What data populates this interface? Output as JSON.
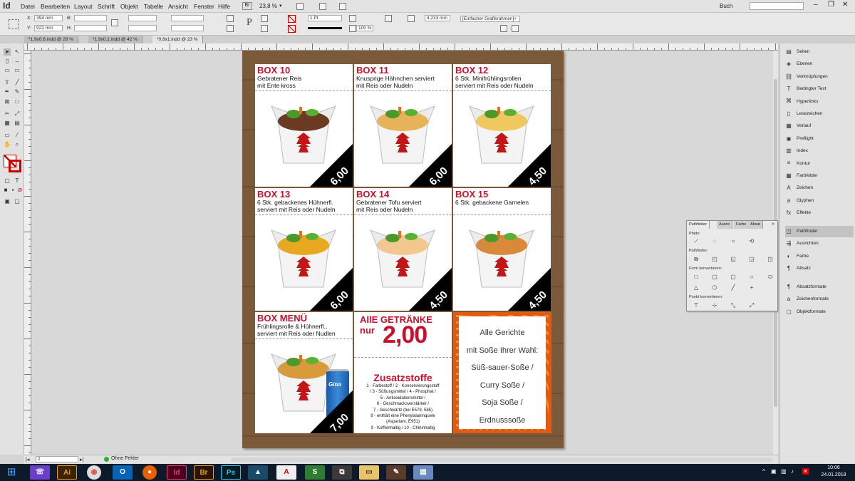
{
  "app": {
    "logo": "Id"
  },
  "menu": [
    "Datei",
    "Bearbeiten",
    "Layout",
    "Schrift",
    "Objekt",
    "Tabelle",
    "Ansicht",
    "Fenster",
    "Hilfe"
  ],
  "zoom": "23,8 %",
  "workspace": "Buch",
  "control": {
    "x_label": "X:",
    "x_value": "394 mm",
    "y_label": "Y:",
    "y_value": "922 mm",
    "b_label": "B:",
    "h_label": "H:",
    "stroke_weight": "1 Pt",
    "percent": "100 %",
    "size_value": "4,233 mm",
    "frame_style": "[Einfacher Grafikrahmen]+"
  },
  "tabs": [
    "*1.9x0.6.indd @ 28 %",
    "*1.9x0.1.indd @ 42 %",
    "*0.8x1.indd @ 23 %"
  ],
  "boxes": [
    {
      "title": "BOX 10",
      "desc1": "Gebratener Reis",
      "desc2": "mit Ente kross",
      "price": "6,00",
      "meat": "#6b3a22"
    },
    {
      "title": "BOX 11",
      "desc1": "Knusprige Hähnchen serviert",
      "desc2": "mit Reis oder Nudeln",
      "price": "6,00",
      "meat": "#e6b25a"
    },
    {
      "title": "BOX 12",
      "desc1": "6 Stk. Minifrühlingsrollen",
      "desc2": "serviert mit Reis oder Nudeln",
      "price": "4,50",
      "meat": "#f0c860"
    },
    {
      "title": "BOX 13",
      "desc1": "6 Stk. gebackenes Hühnerfl.",
      "desc2": "serviert mit Reis oder Nudeln",
      "price": "6,00",
      "meat": "#e8a820"
    },
    {
      "title": "BOX 14",
      "desc1": "Gebratener Tofu serviert",
      "desc2": "mit Reis oder Nudeln",
      "price": "4,50",
      "meat": "#f2c890"
    },
    {
      "title": "BOX 15",
      "desc1": "6 Stk. gebackene Garnelen",
      "desc2": "",
      "price": "4,50",
      "meat": "#d88a3a"
    },
    {
      "title": "BOX MENÜ",
      "desc1": "Frühlingsrolle & Hühnerfl.,",
      "desc2": "serviert mit Reis oder Nudlen",
      "price": "7,00",
      "meat": "#d89a3a"
    }
  ],
  "drinks": {
    "line1": "AllE GETRÄNKE",
    "line2": "nur",
    "price": "2,00"
  },
  "additives": {
    "title": "Zusatzstoffe",
    "lines": [
      "1 - Farbestoff / 2 - Konservierungsstoff",
      "/ 3 - Süßungsmittel / 4 - Phosphat /",
      "5 - Antioxidationsmittel /",
      "6 - Geschmacksverstärker /",
      "7 - Geschwärtz (bei E579, 585)",
      "8 - enthält eine Phenylalaninquele",
      "(Aspartam, E951)",
      "9 - Koffeinhaltig / 10 - Chininhaltig"
    ]
  },
  "sauces": [
    "Alle Gerichte",
    "mit Soße Ihrer Wahl:",
    "Süß-sauer-Soße /",
    "Curry Soße /",
    "Soja Soße /",
    "Erdnusssoße"
  ],
  "can_label": "Gina",
  "panels": [
    "Seiten",
    "Ebenen",
    "Verknüpfungen",
    "Bedingter Text",
    "Hyperlinks",
    "Lesezeichen",
    "Verlauf",
    "Preflight",
    "Index",
    "Kontur",
    "Farbfelder",
    "Zeichen",
    "Glyphen",
    "Effekte"
  ],
  "panels2": [
    "Pathfinder",
    "Ausrichten",
    "Farbe",
    "Absatz"
  ],
  "panels3": [
    "Absatzformate",
    "Zeichenformate",
    "Objektformate"
  ],
  "pathfinder": {
    "tabs": [
      "Pathfinder",
      "Ausric",
      "Farbe",
      "Absat"
    ],
    "sec1": "Pfade:",
    "sec2": "Pathfinder:",
    "sec3": "Form konvertieren:",
    "sec4": "Punkt konvertieren:"
  },
  "status": {
    "page": "2",
    "errors": "Ohne Fehler"
  },
  "clock": {
    "time": "10:06",
    "date": "24.01.2018"
  },
  "taskbar_apps": [
    "Ai",
    "Id",
    "Br",
    "Ps"
  ],
  "colors": {
    "title_red": "#c8102e",
    "wood": "#7a5a3b",
    "accent_orange": "#e05a10"
  }
}
